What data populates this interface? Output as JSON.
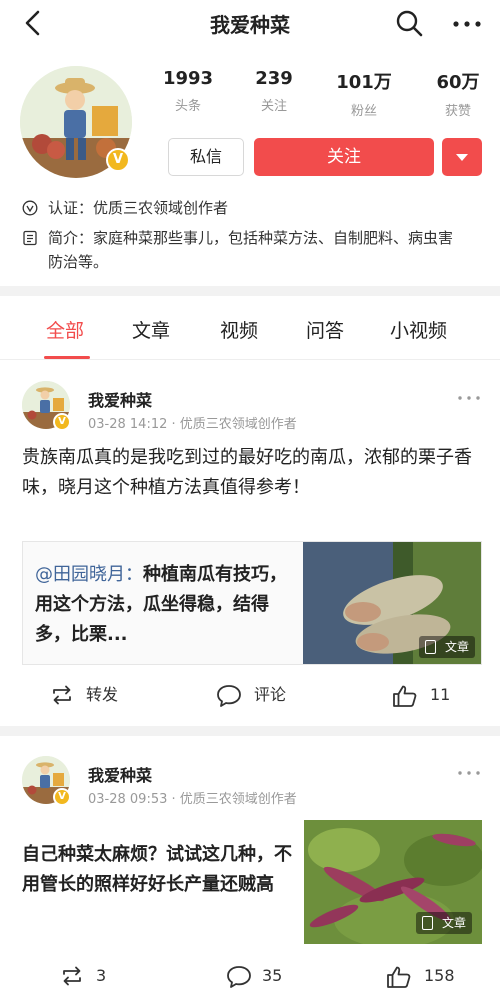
{
  "nav": {
    "title": "我爱种菜"
  },
  "profile": {
    "stats": [
      {
        "num": "1993",
        "label": "头条"
      },
      {
        "num": "239",
        "label": "关注"
      },
      {
        "num": "101万",
        "label": "粉丝"
      },
      {
        "num": "60万",
        "label": "获赞"
      }
    ],
    "message_label": "私信",
    "follow_label": "关注",
    "cert_label": "认证：",
    "cert_value": "优质三农领域创作者",
    "intro_label": "简介：",
    "intro_value": "家庭种菜那些事儿，包括种菜方法、自制肥料、病虫害防治等。"
  },
  "tabs": [
    "全部",
    "文章",
    "视频",
    "问答",
    "小视频"
  ],
  "posts": [
    {
      "author": "我爱种菜",
      "meta": "03-28 14:12 · 优质三农领域创作者",
      "text": "贵族南瓜真的是我吃到过的最好吃的南瓜，浓郁的栗子香味，晓月这个种植方法真值得参考！",
      "quote_at": "@田园晓月：",
      "quote_text": "种植南瓜有技巧，用这个方法，瓜坐得稳，结得多，比栗...",
      "badge": "文章",
      "repost_label": "转发",
      "comment_label": "评论",
      "like_count": "11"
    },
    {
      "author": "我爱种菜",
      "meta": "03-28 09:53 · 优质三农领域创作者",
      "text": "自己种菜太麻烦？试试这几种，不用管长的照样好好长产量还贼高",
      "badge": "文章",
      "repost_count": "3",
      "comment_count": "35",
      "like_count": "158"
    }
  ],
  "colors": {
    "accent": "#f24c4c",
    "mention": "#406599",
    "badge": "#f2b81f"
  }
}
